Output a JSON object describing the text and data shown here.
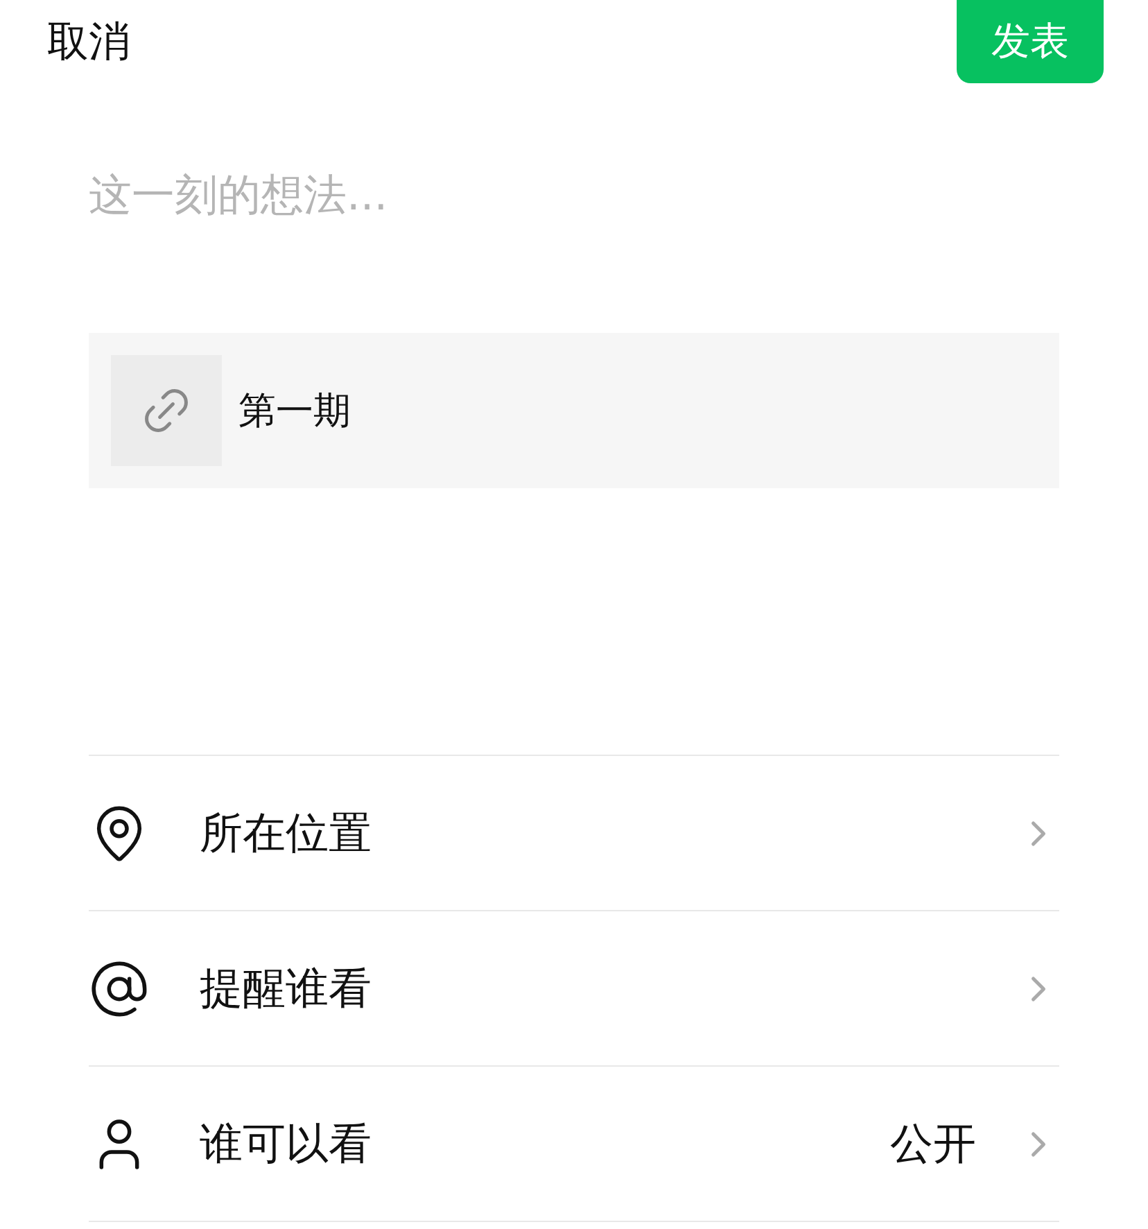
{
  "header": {
    "cancel": "取消",
    "publish": "发表"
  },
  "composer": {
    "placeholder": "这一刻的想法..."
  },
  "link_card": {
    "title": "第一期"
  },
  "options": [
    {
      "kind": "location",
      "label": "所在位置"
    },
    {
      "kind": "mention",
      "label": "提醒谁看"
    },
    {
      "kind": "visibility",
      "label": "谁可以看",
      "value": "公开"
    }
  ]
}
